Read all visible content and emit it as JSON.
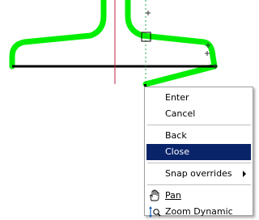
{
  "context_menu": {
    "items": [
      {
        "label": "Enter"
      },
      {
        "label": "Cancel"
      },
      {
        "label": "Back"
      },
      {
        "label": "Close",
        "selected": true
      },
      {
        "label": "Snap overrides",
        "has_submenu": true
      },
      {
        "label": "Pan",
        "icon": "pan-hand-icon"
      },
      {
        "label": "Zoom Dynamic",
        "icon": "zoom-dynamic-icon"
      }
    ]
  },
  "colors": {
    "profile_outline": "#00ee00",
    "base_line": "#000000",
    "axis_line": "#c02040",
    "guide_line": "#22aa44",
    "selection_highlight": "#0a246a"
  }
}
